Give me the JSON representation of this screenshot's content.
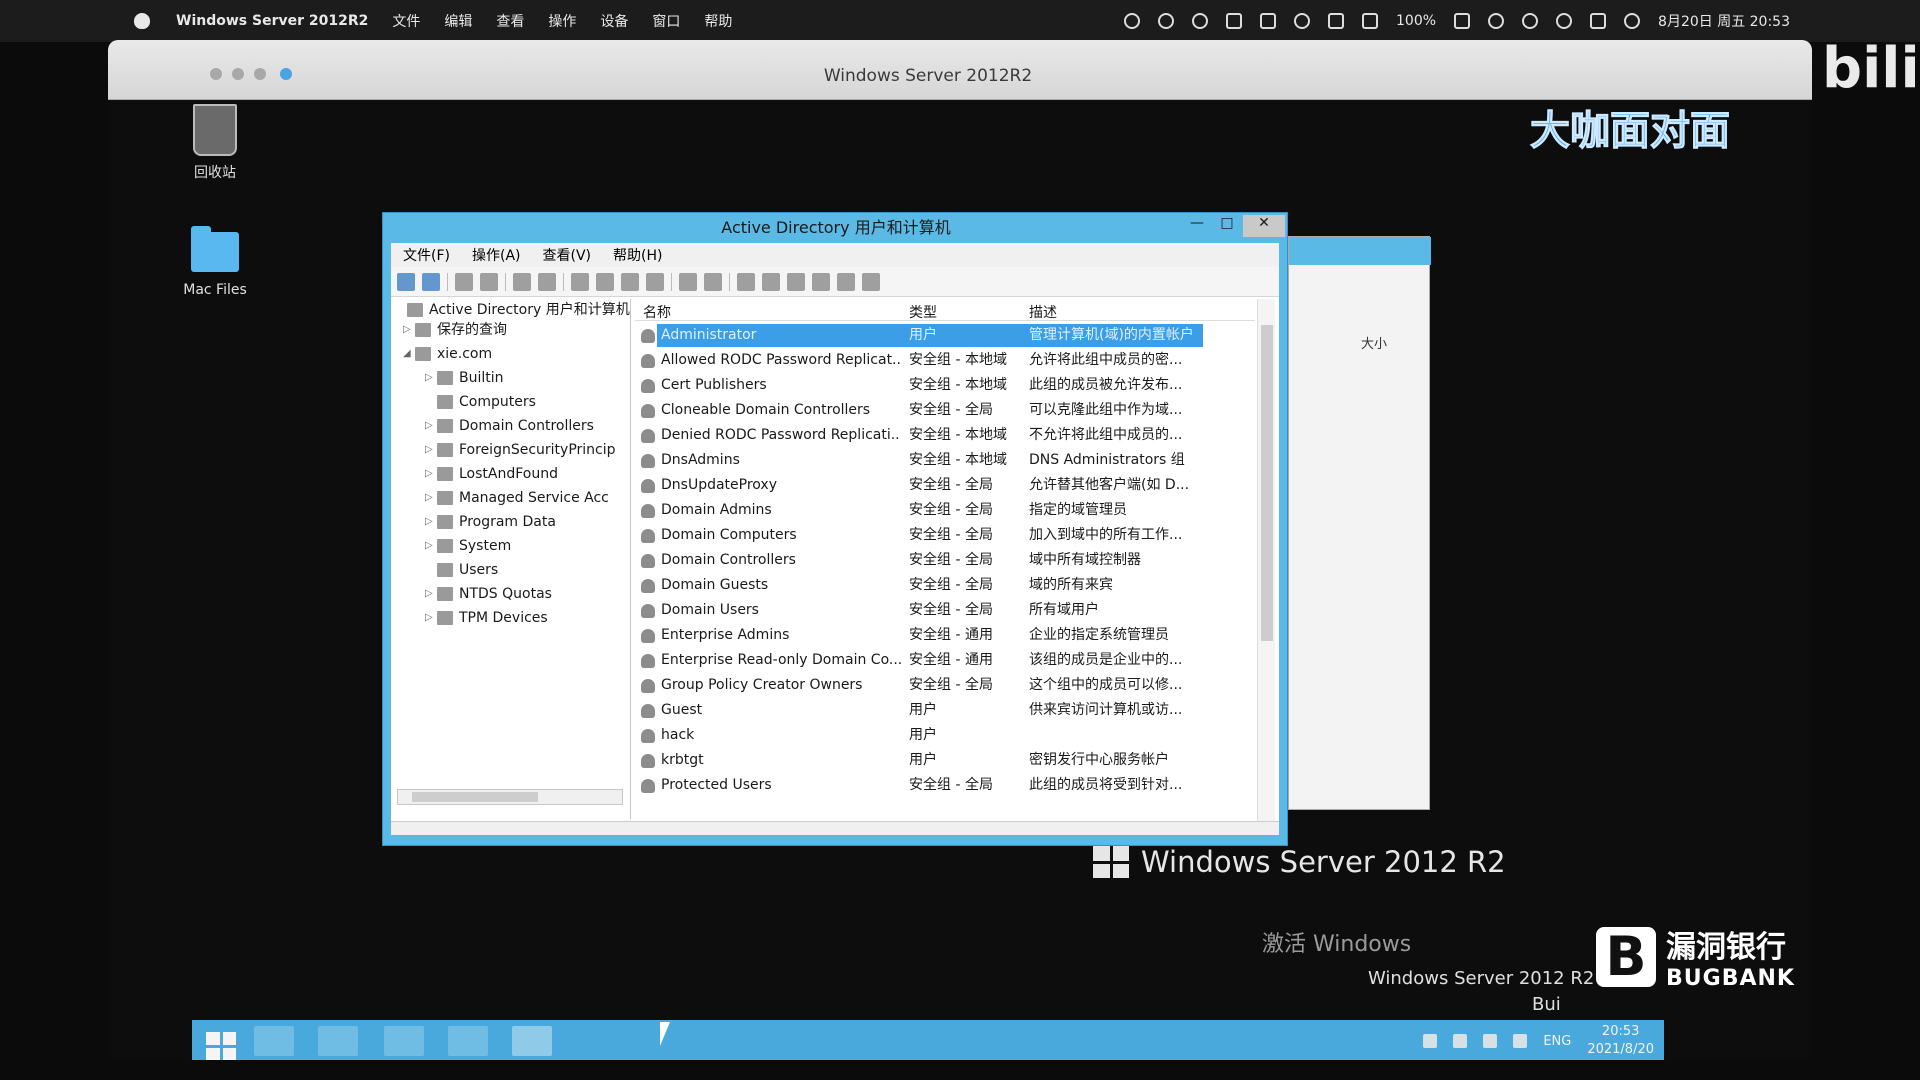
{
  "mac_menubar": {
    "app_name": "Windows Server 2012R2",
    "menus": [
      "文件",
      "编辑",
      "查看",
      "操作",
      "设备",
      "窗口",
      "帮助"
    ],
    "battery": "100%",
    "datetime": "8月20日 周五 20:53"
  },
  "vm_window": {
    "title": "Windows Server 2012R2"
  },
  "desktop": {
    "icons": [
      {
        "label": "回收站",
        "icon": "recycle-bin-icon"
      },
      {
        "label": "Mac Files",
        "icon": "folder-icon"
      }
    ],
    "brand": "Windows Server 2012 R2",
    "activation_title": "激活 Windows",
    "activation_line2": "Windows Server 2012 R2 St",
    "activation_line3": "Bui"
  },
  "ad_window": {
    "title": "Active Directory 用户和计算机",
    "menus": [
      "文件(F)",
      "操作(A)",
      "查看(V)",
      "帮助(H)"
    ],
    "tree": [
      {
        "label": "Active Directory 用户和计算机",
        "level": 0,
        "expander": ""
      },
      {
        "label": "保存的查询",
        "level": 1,
        "expander": "▷"
      },
      {
        "label": "xie.com",
        "level": 1,
        "expander": "◢"
      },
      {
        "label": "Builtin",
        "level": 2,
        "expander": "▷"
      },
      {
        "label": "Computers",
        "level": 2,
        "expander": ""
      },
      {
        "label": "Domain Controllers",
        "level": 2,
        "expander": "▷"
      },
      {
        "label": "ForeignSecurityPrincip",
        "level": 2,
        "expander": "▷"
      },
      {
        "label": "LostAndFound",
        "level": 2,
        "expander": "▷"
      },
      {
        "label": "Managed Service Acc",
        "level": 2,
        "expander": "▷"
      },
      {
        "label": "Program Data",
        "level": 2,
        "expander": "▷"
      },
      {
        "label": "System",
        "level": 2,
        "expander": "▷"
      },
      {
        "label": "Users",
        "level": 2,
        "expander": ""
      },
      {
        "label": "NTDS Quotas",
        "level": 2,
        "expander": "▷"
      },
      {
        "label": "TPM Devices",
        "level": 2,
        "expander": "▷"
      }
    ],
    "columns": [
      "名称",
      "类型",
      "描述"
    ],
    "rows": [
      {
        "name": "Administrator",
        "type": "用户",
        "desc": "管理计算机(域)的内置帐户",
        "selected": true
      },
      {
        "name": "Allowed RODC Password Replicat...",
        "type": "安全组 - 本地域",
        "desc": "允许将此组中成员的密..."
      },
      {
        "name": "Cert Publishers",
        "type": "安全组 - 本地域",
        "desc": "此组的成员被允许发布..."
      },
      {
        "name": "Cloneable Domain Controllers",
        "type": "安全组 - 全局",
        "desc": "可以克隆此组中作为域..."
      },
      {
        "name": "Denied RODC Password Replicati...",
        "type": "安全组 - 本地域",
        "desc": "不允许将此组中成员的..."
      },
      {
        "name": "DnsAdmins",
        "type": "安全组 - 本地域",
        "desc": "DNS Administrators 组"
      },
      {
        "name": "DnsUpdateProxy",
        "type": "安全组 - 全局",
        "desc": "允许替其他客户端(如 D..."
      },
      {
        "name": "Domain Admins",
        "type": "安全组 - 全局",
        "desc": "指定的域管理员"
      },
      {
        "name": "Domain Computers",
        "type": "安全组 - 全局",
        "desc": "加入到域中的所有工作..."
      },
      {
        "name": "Domain Controllers",
        "type": "安全组 - 全局",
        "desc": "域中所有域控制器"
      },
      {
        "name": "Domain Guests",
        "type": "安全组 - 全局",
        "desc": "域的所有来宾"
      },
      {
        "name": "Domain Users",
        "type": "安全组 - 全局",
        "desc": "所有域用户"
      },
      {
        "name": "Enterprise Admins",
        "type": "安全组 - 通用",
        "desc": "企业的指定系统管理员"
      },
      {
        "name": "Enterprise Read-only Domain Co...",
        "type": "安全组 - 通用",
        "desc": "该组的成员是企业中的..."
      },
      {
        "name": "Group Policy Creator Owners",
        "type": "安全组 - 全局",
        "desc": "这个组中的成员可以修..."
      },
      {
        "name": "Guest",
        "type": "用户",
        "desc": "供来宾访问计算机或访..."
      },
      {
        "name": "hack",
        "type": "用户",
        "desc": ""
      },
      {
        "name": "krbtgt",
        "type": "用户",
        "desc": "密钥发行中心服务帐户"
      },
      {
        "name": "Protected Users",
        "type": "安全组 - 全局",
        "desc": "此组的成员将受到针对..."
      }
    ]
  },
  "back_window": {
    "column_label": "大小"
  },
  "taskbar": {
    "tray_lang": "ENG",
    "time": "20:53",
    "date": "2021/8/20"
  },
  "watermarks": {
    "show_name": "大咖面对面",
    "site": "bili",
    "bug_letter": "B",
    "bug_cn": "漏洞银行",
    "bug_en": "BUGBANK"
  }
}
